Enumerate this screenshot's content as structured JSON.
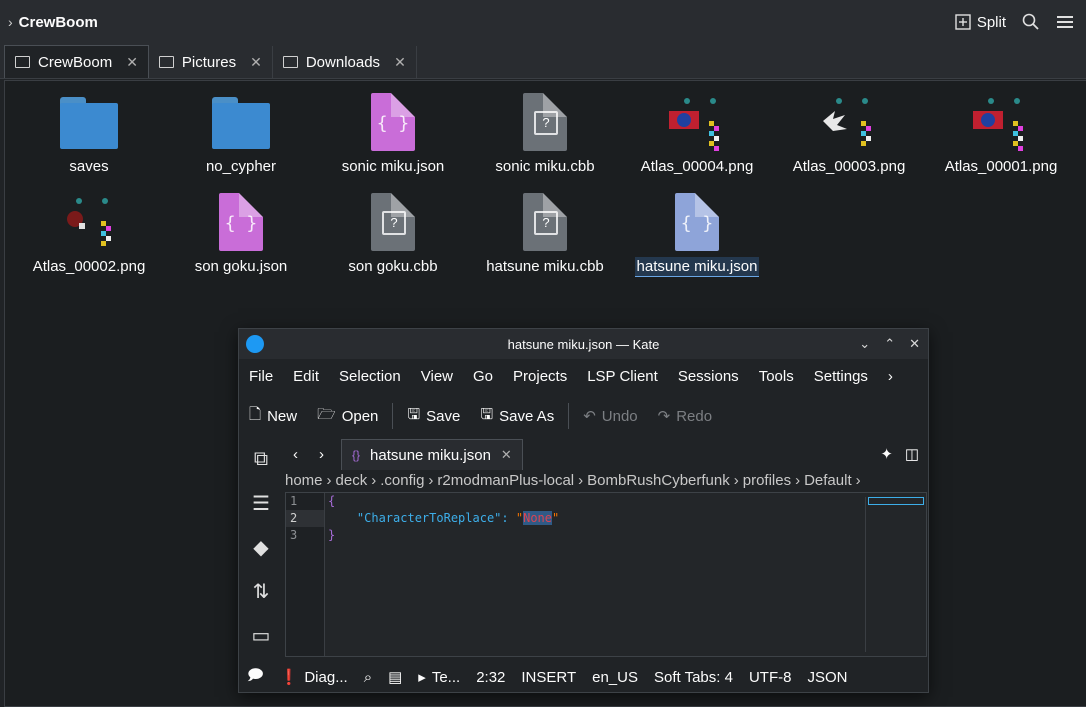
{
  "window": {
    "title": "CrewBoom",
    "split_label": "Split"
  },
  "tabs": [
    {
      "label": "CrewBoom"
    },
    {
      "label": "Pictures"
    },
    {
      "label": "Downloads"
    }
  ],
  "files": [
    {
      "name": "saves",
      "kind": "folder"
    },
    {
      "name": "no_cypher",
      "kind": "folder"
    },
    {
      "name": "sonic miku.json",
      "kind": "json"
    },
    {
      "name": "sonic miku.cbb",
      "kind": "cbb"
    },
    {
      "name": "Atlas_00004.png",
      "kind": "png"
    },
    {
      "name": "Atlas_00003.png",
      "kind": "png"
    },
    {
      "name": "Atlas_00001.png",
      "kind": "png"
    },
    {
      "name": "Atlas_00002.png",
      "kind": "png"
    },
    {
      "name": "son goku.json",
      "kind": "json"
    },
    {
      "name": "son goku.cbb",
      "kind": "cbb"
    },
    {
      "name": "hatsune miku.cbb",
      "kind": "cbb"
    },
    {
      "name": "hatsune miku.json",
      "kind": "json",
      "selected": true
    }
  ],
  "kate": {
    "title": "hatsune miku.json — Kate",
    "menu": [
      "File",
      "Edit",
      "Selection",
      "View",
      "Go",
      "Projects",
      "LSP Client",
      "Sessions",
      "Tools",
      "Settings"
    ],
    "toolbar": {
      "new": "New",
      "open": "Open",
      "save": "Save",
      "save_as": "Save As",
      "undo": "Undo",
      "redo": "Redo"
    },
    "tab": "hatsune miku.json",
    "breadcrumb": [
      "home",
      "deck",
      ".config",
      "r2modmanPlus-local",
      "BombRushCyberfunk",
      "profiles",
      "Default"
    ],
    "lines": [
      "1",
      "2",
      "3"
    ],
    "code": {
      "open": "{",
      "key": "\"CharacterToReplace\"",
      "colon": ": ",
      "q1": "\"",
      "value": "None",
      "q2": "\"",
      "close": "}"
    },
    "status": {
      "diag": "Diag...",
      "term": "Te...",
      "cursor": "2:32",
      "mode": "INSERT",
      "lang": "en_US",
      "tabs": "Soft Tabs: 4",
      "enc": "UTF-8",
      "syntax": "JSON"
    }
  },
  "colors": {
    "accent": "#3daee9",
    "json_icon": "#c96dd8",
    "folder": "#3c8ad0"
  }
}
